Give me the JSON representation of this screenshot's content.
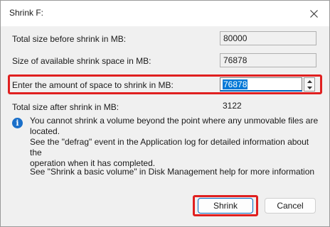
{
  "window": {
    "title": "Shrink F:",
    "close_icon": "close-icon"
  },
  "fields": [
    {
      "label": "Total size before shrink in MB:",
      "value": "80000"
    },
    {
      "label": "Size of available shrink space in MB:",
      "value": "76878"
    },
    {
      "label": "Enter the amount of space to shrink in MB:",
      "value": "76878"
    },
    {
      "label": "Total size after shrink in MB:",
      "value": "3122"
    }
  ],
  "info": {
    "icon": "info-icon",
    "text": "You cannot shrink a volume beyond the point where any unmovable files are located.\nSee the \"defrag\" event in the Application log for detailed information about the\noperation when it has completed.",
    "help": "See \"Shrink a basic volume\" in Disk Management help for more information"
  },
  "buttons": {
    "shrink": "Shrink",
    "cancel": "Cancel"
  },
  "colors": {
    "highlight": "#e02020",
    "selection": "#0078d7",
    "accent": "#0067c0"
  }
}
